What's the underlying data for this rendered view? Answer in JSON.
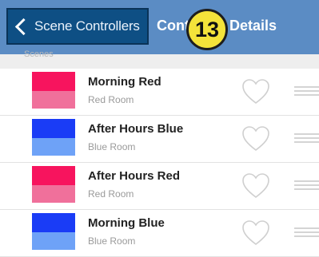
{
  "header": {
    "back_label": "Scene Controllers",
    "title": "Controller Details",
    "badge": "13",
    "colors": {
      "bar": "#5b8cc4",
      "back_button": "#0e4f84",
      "badge": "#f4e33a"
    }
  },
  "section": {
    "label": "Scenes"
  },
  "scenes": [
    {
      "name": "Morning Red",
      "room": "Red Room",
      "color_top": "#f7145e",
      "color_bottom": "#f0709b"
    },
    {
      "name": "After Hours Blue",
      "room": "Blue Room",
      "color_top": "#1a3cf6",
      "color_bottom": "#6ea2f7"
    },
    {
      "name": "After Hours Red",
      "room": "Red Room",
      "color_top": "#f7145e",
      "color_bottom": "#f0709b"
    },
    {
      "name": "Morning Blue",
      "room": "Blue Room",
      "color_top": "#1a3cf6",
      "color_bottom": "#6ea2f7"
    }
  ],
  "icons": {
    "back": "chevron-left-icon",
    "favorite": "heart-outline-icon",
    "reorder": "drag-handle-icon"
  }
}
